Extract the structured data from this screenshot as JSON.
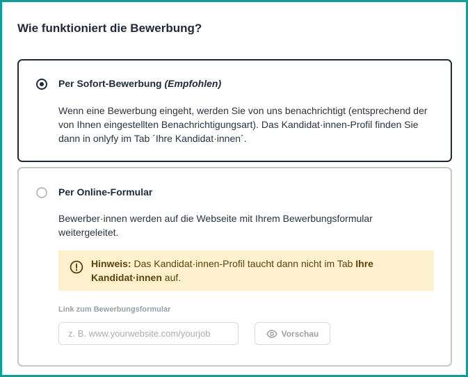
{
  "section": {
    "title": "Wie funktioniert die Bewerbung?"
  },
  "options": {
    "sofort": {
      "selected": true,
      "title": "Per Sofort-Bewerbung",
      "title_note": "(Empfohlen)",
      "description": "Wenn eine Bewerbung eingeht, werden Sie von uns benachrichtigt (entsprechend der von Ihnen eingestellten Benachrichtigungsart). Das Kandidat·innen-Profil finden Sie dann in onlyfy im Tab ´Ihre Kandidat·innen´."
    },
    "online": {
      "selected": false,
      "title": "Per Online-Formular",
      "description": "Bewerber·innen werden auf die Webseite mit Ihrem Bewerbungsformular weitergeleitet.",
      "hint": {
        "icon": "exclamation-circle-icon",
        "label": "Hinweis:",
        "text_before": " Das Kandidat·innen-Profil taucht dann nicht im Tab ",
        "tab_name": "Ihre Kandidat·innen",
        "text_after": " auf."
      },
      "link_field": {
        "label": "Link zum Bewerbungsformular",
        "value": "",
        "placeholder": "z. B. www.yourwebsite.com/yourjob"
      },
      "preview_button": {
        "icon": "eye-icon",
        "label": "Vorschau"
      }
    }
  },
  "colors": {
    "frame_border": "#0f9d95",
    "selected_border": "#1f2937",
    "hint_background": "#fdf0cc",
    "hint_text": "#5c4310"
  }
}
